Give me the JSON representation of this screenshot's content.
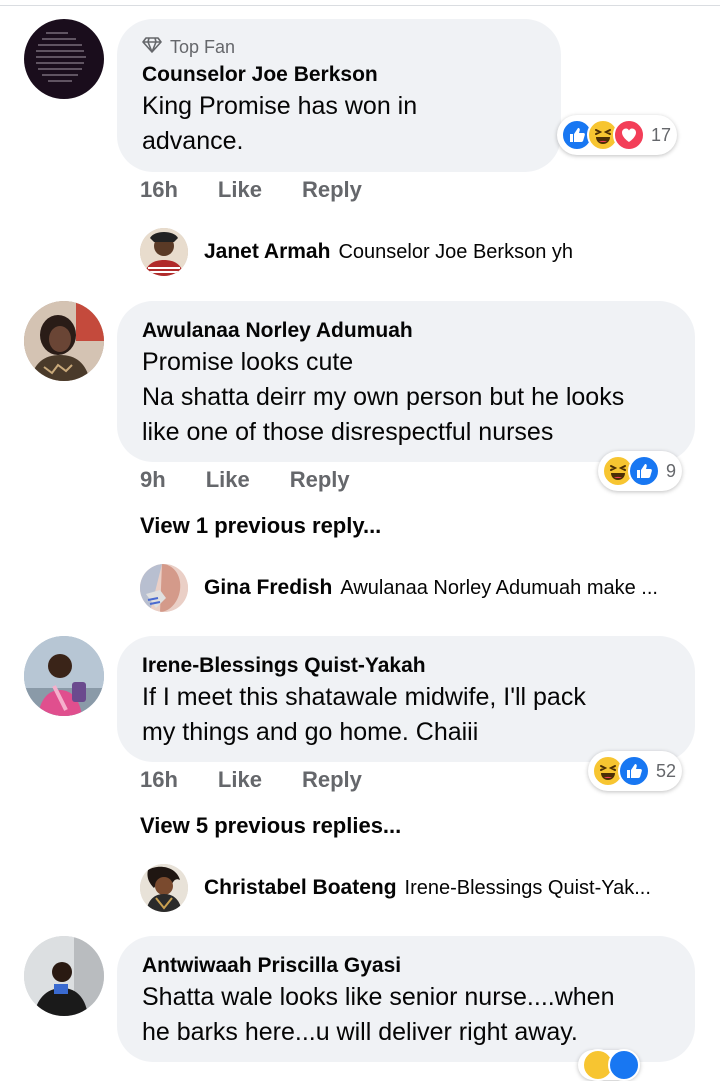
{
  "comments": [
    {
      "badge": "Top Fan",
      "author": "Counselor Joe Berkson",
      "lines": [
        "King Promise has won in",
        "advance."
      ],
      "time": "16h",
      "like": "Like",
      "reply": "Reply",
      "reaction_count": "17",
      "reactions": [
        "like-icon",
        "haha-icon",
        "love-icon"
      ]
    },
    {
      "author": "Awulanaa Norley Adumuah",
      "lines": [
        "Promise looks cute",
        "Na shatta deirr my own person but he looks",
        "like one of those disrespectful nurses"
      ],
      "time": "9h",
      "like": "Like",
      "reply": "Reply",
      "reaction_count": "9",
      "reactions": [
        "haha-icon",
        "like-icon"
      ],
      "view_previous": "View 1 previous reply..."
    },
    {
      "author": "Irene-Blessings Quist-Yakah",
      "lines": [
        "If I meet this  shatawale midwife, I'll pack",
        "my things and go home. Chaiii"
      ],
      "time": "16h",
      "like": "Like",
      "reply": "Reply",
      "reaction_count": "52",
      "reactions": [
        "haha-icon",
        "like-icon"
      ],
      "view_previous": "View 5 previous replies..."
    },
    {
      "author": "Antwiwaah Priscilla Gyasi",
      "lines": [
        "Shatta wale looks like senior nurse....when",
        "he barks here...u will deliver right away."
      ]
    }
  ],
  "replies": [
    {
      "author": "Janet Armah",
      "text": "Counselor Joe Berkson yh"
    },
    {
      "author": "Gina Fredish",
      "text": "Awulanaa Norley Adumuah make ..."
    },
    {
      "author": "Christabel Boateng",
      "text": "Irene-Blessings Quist-Yak..."
    }
  ],
  "colors": {
    "bubble": "#f0f2f5",
    "secondary_text": "#65676b",
    "like_blue": "#1877f2",
    "haha_yellow": "#f7c531",
    "love_red": "#f33e58"
  }
}
